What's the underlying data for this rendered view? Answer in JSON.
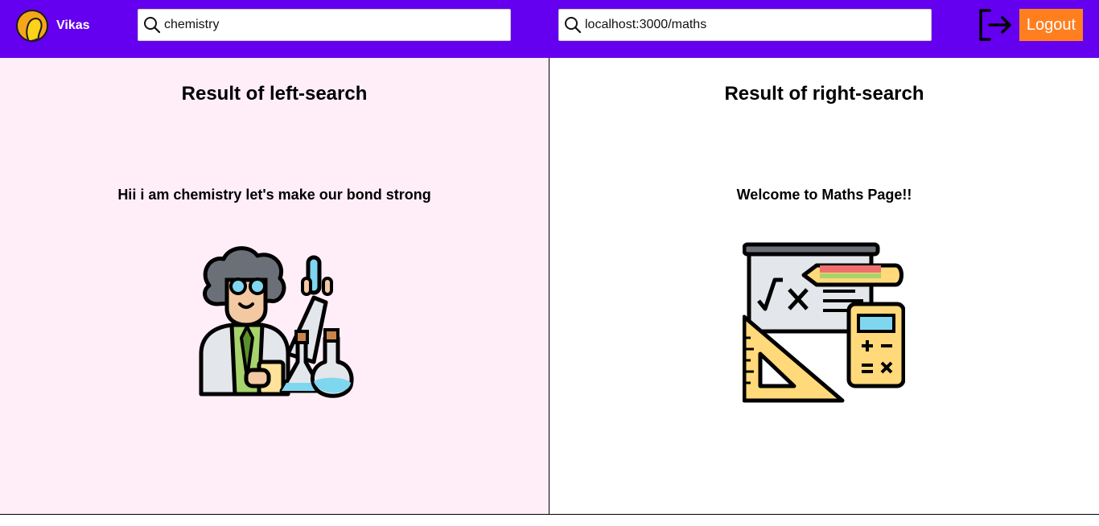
{
  "header": {
    "user_name": "Vikas",
    "left_search": {
      "value": "chemistry"
    },
    "right_search": {
      "value": "localhost:3000/maths"
    },
    "logout_label": "Logout"
  },
  "left_pane": {
    "title": "Result of left-search",
    "message": "Hii i am chemistry let's make our bond strong",
    "illustration": "chemist-icon"
  },
  "right_pane": {
    "title": "Result of right-search",
    "message": "Welcome to Maths Page!!",
    "illustration": "maths-board-icon"
  },
  "colors": {
    "topbar": "#6400ef",
    "logout_button": "#ff7f1f",
    "left_pane_bg": "#ffeef8",
    "right_pane_bg": "#ffffff"
  }
}
